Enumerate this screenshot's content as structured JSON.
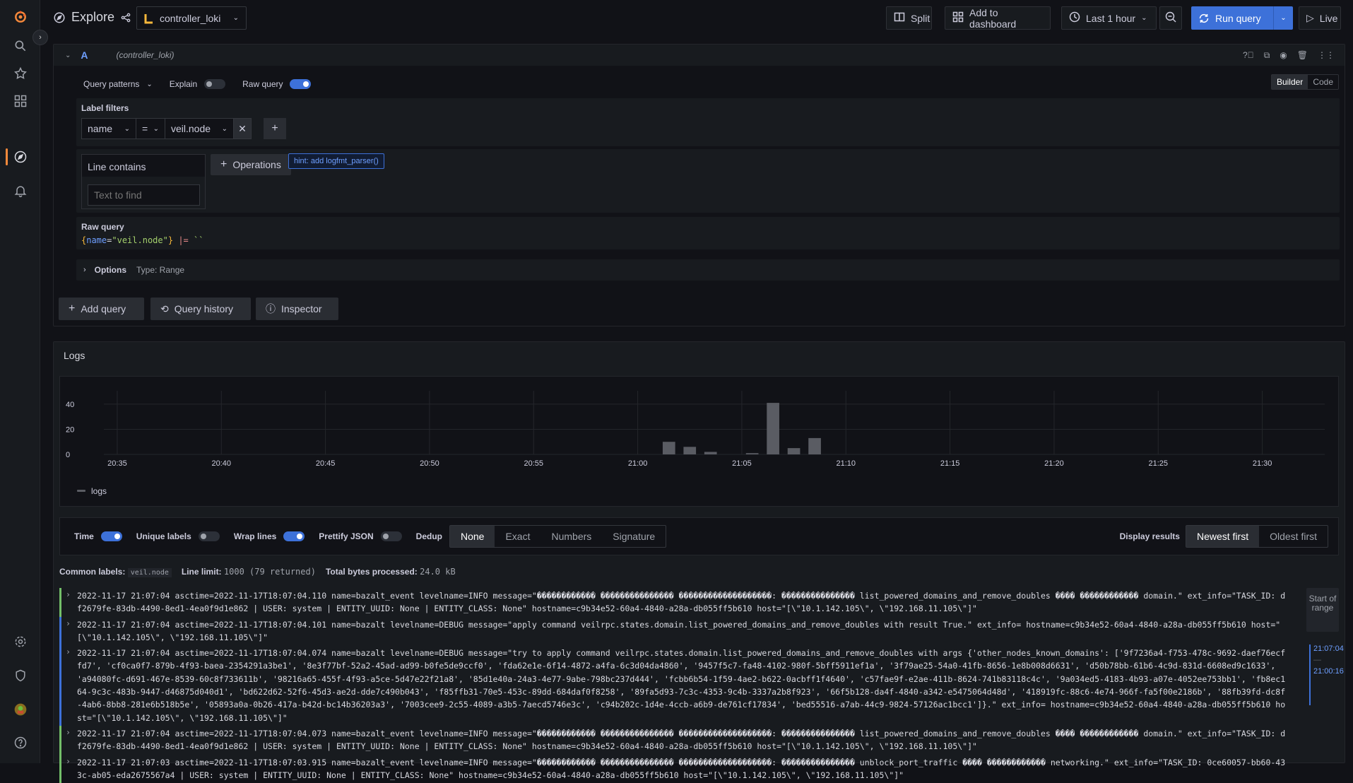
{
  "topbar": {
    "title": "Explore",
    "datasource": "controller_loki",
    "split_label": "Split",
    "add_dashboard_label": "Add to dashboard",
    "time_range": "Last 1 hour",
    "run_label": "Run query",
    "live_label": "Live"
  },
  "query": {
    "ref": "A",
    "ds_hint": "(controller_loki)",
    "patterns_label": "Query patterns",
    "explain_label": "Explain",
    "raw_query_label": "Raw query",
    "builder_label": "Builder",
    "code_label": "Code",
    "label_filters_title": "Label filters",
    "filter_label": "name",
    "filter_op": "=",
    "filter_value": "veil.node",
    "line_contains_label": "Line contains",
    "text_placeholder": "Text to find",
    "operations_label": "Operations",
    "hint_label": "hint: add logfmt_parser()",
    "raw_title": "Raw query",
    "raw_open": "{",
    "raw_key": "name",
    "raw_eq": "=",
    "raw_val": "\"veil.node\"",
    "raw_close": "}",
    "raw_pipe": " |= ",
    "raw_str": "``",
    "options_label": "Options",
    "options_type": "Type: Range",
    "add_query_label": "Add query",
    "history_label": "Query history",
    "inspector_label": "Inspector"
  },
  "logs": {
    "title": "Logs",
    "legend": "logs",
    "time_label": "Time",
    "unique_label": "Unique labels",
    "wrap_label": "Wrap lines",
    "prettify_label": "Prettify JSON",
    "dedup_label": "Dedup",
    "dedup_options": [
      "None",
      "Exact",
      "Numbers",
      "Signature"
    ],
    "display_label": "Display results",
    "newest_label": "Newest first",
    "oldest_label": "Oldest first",
    "common_label": "Common labels:",
    "common_value": "veil.node",
    "line_limit_label": "Line limit:",
    "line_limit_value": "1000 (79 returned)",
    "bytes_label": "Total bytes processed:",
    "bytes_value": "24.0 kB",
    "start_range": "Start of range",
    "range_top": "21:07:04",
    "range_dash": "—",
    "range_bottom": "21:00:16",
    "rows": [
      {
        "ts": "2022-11-17 21:07:04",
        "level": "info",
        "text": "asctime=2022-11-17T18:07:04.110 name=bazalt_event levelname=INFO message=\"������������ ��������������� �������������������:  ��������������� list_powered_domains_and_remove_doubles ���� ������������ domain.\" ext_info=\"TASK_ID: df2679fe-83db-4490-8ed1-4ea0f9d1e862 | USER: system | ENTITY_UUID: None | ENTITY_CLASS: None\" hostname=c9b34e52-60a4-4840-a28a-db055ff5b610 host=\"[\\\"10.1.142.105\\\", \\\"192.168.11.105\\\"]\""
      },
      {
        "ts": "2022-11-17 21:07:04",
        "level": "debug",
        "text": "asctime=2022-11-17T18:07:04.101 name=bazalt levelname=DEBUG message=\"apply command veilrpc.states.domain.list_powered_domains_and_remove_doubles with result True.\" ext_info= hostname=c9b34e52-60a4-4840-a28a-db055ff5b610 host=\"[\\\"10.1.142.105\\\", \\\"192.168.11.105\\\"]\""
      },
      {
        "ts": "2022-11-17 21:07:04",
        "level": "debug",
        "text": "asctime=2022-11-17T18:07:04.074 name=bazalt levelname=DEBUG message=\"try to apply command veilrpc.states.domain.list_powered_domains_and_remove_doubles with args {'other_nodes_known_domains': ['9f7236a4-f753-478c-9692-daef76ecffd7', 'cf0ca0f7-879b-4f93-baea-2354291a3be1', '8e3f77bf-52a2-45ad-ad99-b0fe5de9ccf0', 'fda62e1e-6f14-4872-a4fa-6c3d04da4860', '9457f5c7-fa48-4102-980f-5bff5911ef1a', '3f79ae25-54a0-41fb-8656-1e8b008d6631', 'd50b78bb-61b6-4c9d-831d-6608ed9c1633', 'a94080fc-d691-467e-8539-60c8f733611b', '98216a65-455f-4f93-a5ce-5d47e22f21a8', '85d1e40a-24a3-4e77-9abe-798bc237d444', 'fcbb6b54-1f59-4ae2-b622-0acbff1f4640', 'c57fae9f-e2ae-411b-8624-741b83118c4c', '9a034ed5-4183-4b93-a07e-4052ee753bb1', 'fb8ec164-9c3c-483b-9447-d46875d040d1', 'bd622d62-52f6-45d3-ae2d-dde7c490b043', 'f85ffb31-70e5-453c-89dd-684daf0f8258', '89fa5d93-7c3c-4353-9c4b-3337a2b8f923', '66f5b128-da4f-4840-a342-e5475064d48d', '418919fc-88c6-4e74-966f-fa5f00e2186b', '88fb39fd-dc8f-4ab6-8bb8-281e6b518b5e', '05893a0a-0b26-417a-b42d-bc14b36203a3', '7003cee9-2c55-4089-a3b5-7aecd5746e3c', 'c94b202c-1d4e-4ccb-a6b9-de761cf17834', 'bed55516-a7ab-44c9-9824-57126ac1bcc1']}.\" ext_info= hostname=c9b34e52-60a4-4840-a28a-db055ff5b610 host=\"[\\\"10.1.142.105\\\", \\\"192.168.11.105\\\"]\""
      },
      {
        "ts": "2022-11-17 21:07:04",
        "level": "info",
        "text": "asctime=2022-11-17T18:07:04.073 name=bazalt_event levelname=INFO message=\"������������ ��������������� �������������������:  ��������������� list_powered_domains_and_remove_doubles ���� ������������ domain.\" ext_info=\"TASK_ID: df2679fe-83db-4490-8ed1-4ea0f9d1e862 | USER: system | ENTITY_UUID: None | ENTITY_CLASS: None\" hostname=c9b34e52-60a4-4840-a28a-db055ff5b610 host=\"[\\\"10.1.142.105\\\", \\\"192.168.11.105\\\"]\""
      },
      {
        "ts": "2022-11-17 21:07:03",
        "level": "info",
        "text": "asctime=2022-11-17T18:07:03.915 name=bazalt_event levelname=INFO message=\"������������ ��������������� �������������������:  ��������������� unblock_port_traffic ���� ������������ networking.\" ext_info=\"TASK_ID: 0ce60057-bb60-433c-ab05-eda2675567a4 | USER: system | ENTITY_UUID: None | ENTITY_CLASS: None\" hostname=c9b34e52-60a4-4840-a28a-db055ff5b610 host=\"[\\\"10.1.142.105\\\", \\\"192.168.11.105\\\"]\""
      }
    ]
  },
  "chart_data": {
    "type": "bar",
    "title": "",
    "legend": [
      "logs"
    ],
    "x_ticks": [
      "20:35",
      "20:40",
      "20:45",
      "20:50",
      "20:55",
      "21:00",
      "21:05",
      "21:10",
      "21:15",
      "21:20",
      "21:25",
      "21:30"
    ],
    "y_ticks": [
      0,
      20,
      40
    ],
    "ylim": [
      0,
      45
    ],
    "xlim": [
      "20:33",
      "21:33"
    ],
    "series": [
      {
        "name": "logs",
        "x": [
          "21:01",
          "21:02",
          "21:03",
          "21:05",
          "21:06",
          "21:07",
          "21:08"
        ],
        "values": [
          10,
          6,
          2,
          1,
          41,
          5,
          13
        ]
      }
    ],
    "grid": true,
    "bar_color": "#5a5c63"
  },
  "colors": {
    "accent": "#3d71d9",
    "info": "#73bf69",
    "debug": "#3d71d9",
    "brand": "#f5893b"
  }
}
